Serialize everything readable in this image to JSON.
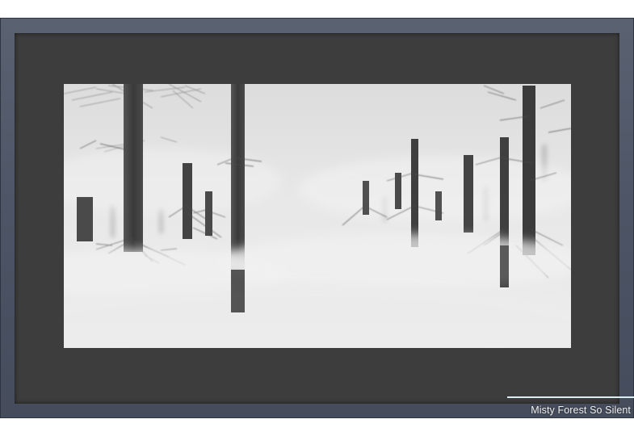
{
  "caption": {
    "title": "Misty Forest So Silent"
  },
  "colors": {
    "frame": "#4c5465",
    "mat": "#3d3d3d",
    "paper": "#e9e9e9",
    "trunk": "#3a3a3a",
    "accent_line": "#d8eef0"
  },
  "artwork": {
    "subject": "misty-pine-forest-pencil-drawing"
  }
}
